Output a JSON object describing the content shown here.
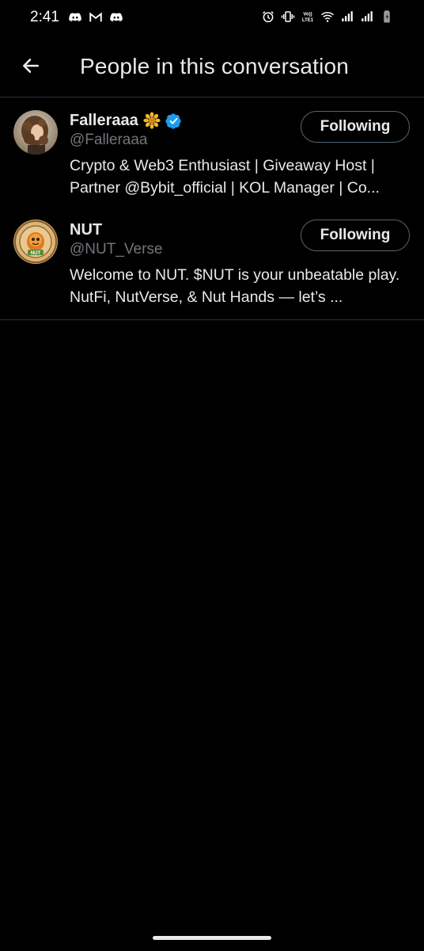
{
  "status_bar": {
    "time": "2:41",
    "left_icons": [
      "discord-icon",
      "gmail-icon",
      "discord-icon"
    ],
    "right_icons": [
      "alarm-icon",
      "vibrate-icon",
      "volte-icon",
      "wifi-icon",
      "signal-icon",
      "signal-icon",
      "battery-icon"
    ]
  },
  "header": {
    "title": "People in this conversation",
    "back_icon": "arrow-left-icon"
  },
  "users": [
    {
      "display_name": "Falleraaa",
      "name_emoji": "sunflower-emoji-icon",
      "verified": true,
      "handle": "@Falleraaa",
      "bio": "Crypto & Web3 Enthusiast | Giveaway Host | Partner @Bybit_official | KOL Manager | Co...",
      "follow_label": "Following"
    },
    {
      "display_name": "NUT",
      "verified": false,
      "handle": "@NUT_Verse",
      "bio": "Welcome to NUT. $NUT is your unbeatable play. NutFi, NutVerse, & Nut Hands — let’s ...",
      "follow_label": "Following"
    }
  ],
  "colors": {
    "background": "#000000",
    "primary_text": "#e7e9ea",
    "secondary_text": "#71767b",
    "divider": "#2f3336",
    "verified_blue": "#1d9bf0"
  }
}
